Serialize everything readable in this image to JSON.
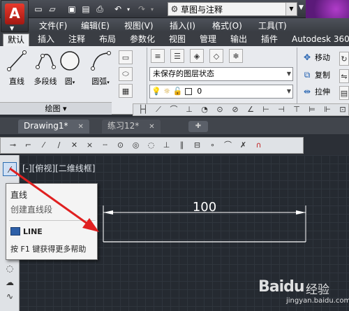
{
  "quick_access": {
    "workspace": "草图与注释",
    "icons": [
      "new-icon",
      "open-icon",
      "save-icon",
      "saveas-icon",
      "print-icon",
      "undo-icon",
      "redo-icon"
    ]
  },
  "menu": [
    "文件(F)",
    "编辑(E)",
    "视图(V)",
    "插入(I)",
    "格式(O)",
    "工具(T)"
  ],
  "ribbon_tabs": [
    "默认",
    "插入",
    "注释",
    "布局",
    "参数化",
    "视图",
    "管理",
    "输出",
    "插件",
    "Autodesk 360"
  ],
  "draw_panel": {
    "tools": [
      "直线",
      "多段线",
      "圆",
      "圆弧"
    ],
    "label": "绘图"
  },
  "layers": {
    "state": "未保存的图层状态",
    "current_layer": "0"
  },
  "modify": {
    "items": [
      "移动",
      "复制",
      "拉伸"
    ]
  },
  "file_tabs": [
    {
      "name": "Drawing1*",
      "close": "✕"
    },
    {
      "name": "练习12*",
      "close": "✕"
    }
  ],
  "viewport": {
    "label": "[-][俯视][二维线框]"
  },
  "drawing": {
    "dimension_text": "100"
  },
  "tooltip": {
    "title": "直线",
    "description": "创建直线段",
    "command": "LINE",
    "help": "按 F1 键获得更多帮助"
  },
  "watermark": {
    "logo": "Baidu",
    "text": "经验",
    "url": "jingyan.baidu.com"
  },
  "colors": {
    "annotation_arrow": "#e02020",
    "canvas_bg": "#252a31",
    "dimension_line": "#ffffff"
  }
}
